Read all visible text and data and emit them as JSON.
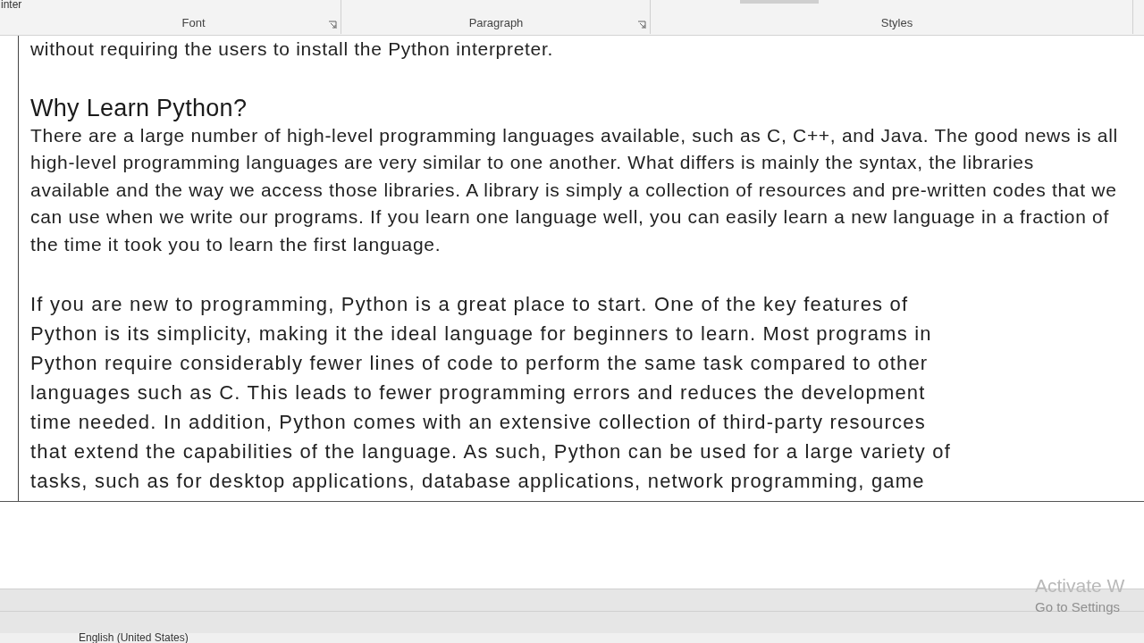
{
  "ribbon": {
    "clipped_label": "inter",
    "groups": [
      {
        "label": "Font",
        "launcher": true
      },
      {
        "label": "Paragraph",
        "launcher": true
      },
      {
        "label": "Styles",
        "launcher": false
      }
    ]
  },
  "document": {
    "blocks": [
      {
        "kind": "paragraph",
        "lines": [
          "without requiring the users to install the Python interpreter."
        ]
      },
      {
        "kind": "heading",
        "text": "Why Learn Python?"
      },
      {
        "kind": "paragraph",
        "lines": [
          "There are a large number of high-level programming languages available, such as C, C++, and Java. The good news is all",
          "high-level programming languages are very similar to one another. What differs is mainly the syntax, the libraries",
          "available and the way we access those libraries. A library is simply a collection of resources and pre-written codes that we",
          "can use when we write our programs. If you learn one language well, you can easily learn a new language in a fraction of",
          "the time it took you to learn the first language."
        ]
      },
      {
        "kind": "spaced",
        "lines": [
          "If you are new to programming, Python is a great place to start. One of the key features of",
          "Python is its simplicity, making it the ideal language for beginners to learn. Most programs in",
          "Python require considerably fewer lines of code to perform the same task compared to other",
          "languages such as C. This leads to fewer programming errors and reduces the development",
          "time needed. In addition, Python comes with an extensive collection of third-party resources",
          "that extend the capabilities of the language. As such, Python can be used for a large variety of",
          "tasks, such as for desktop applications, database applications, network programming, game"
        ]
      }
    ]
  },
  "activation": {
    "title": "Activate W",
    "subtitle": "Go to Settings"
  },
  "status_bar": {
    "language": "English (United States)"
  }
}
